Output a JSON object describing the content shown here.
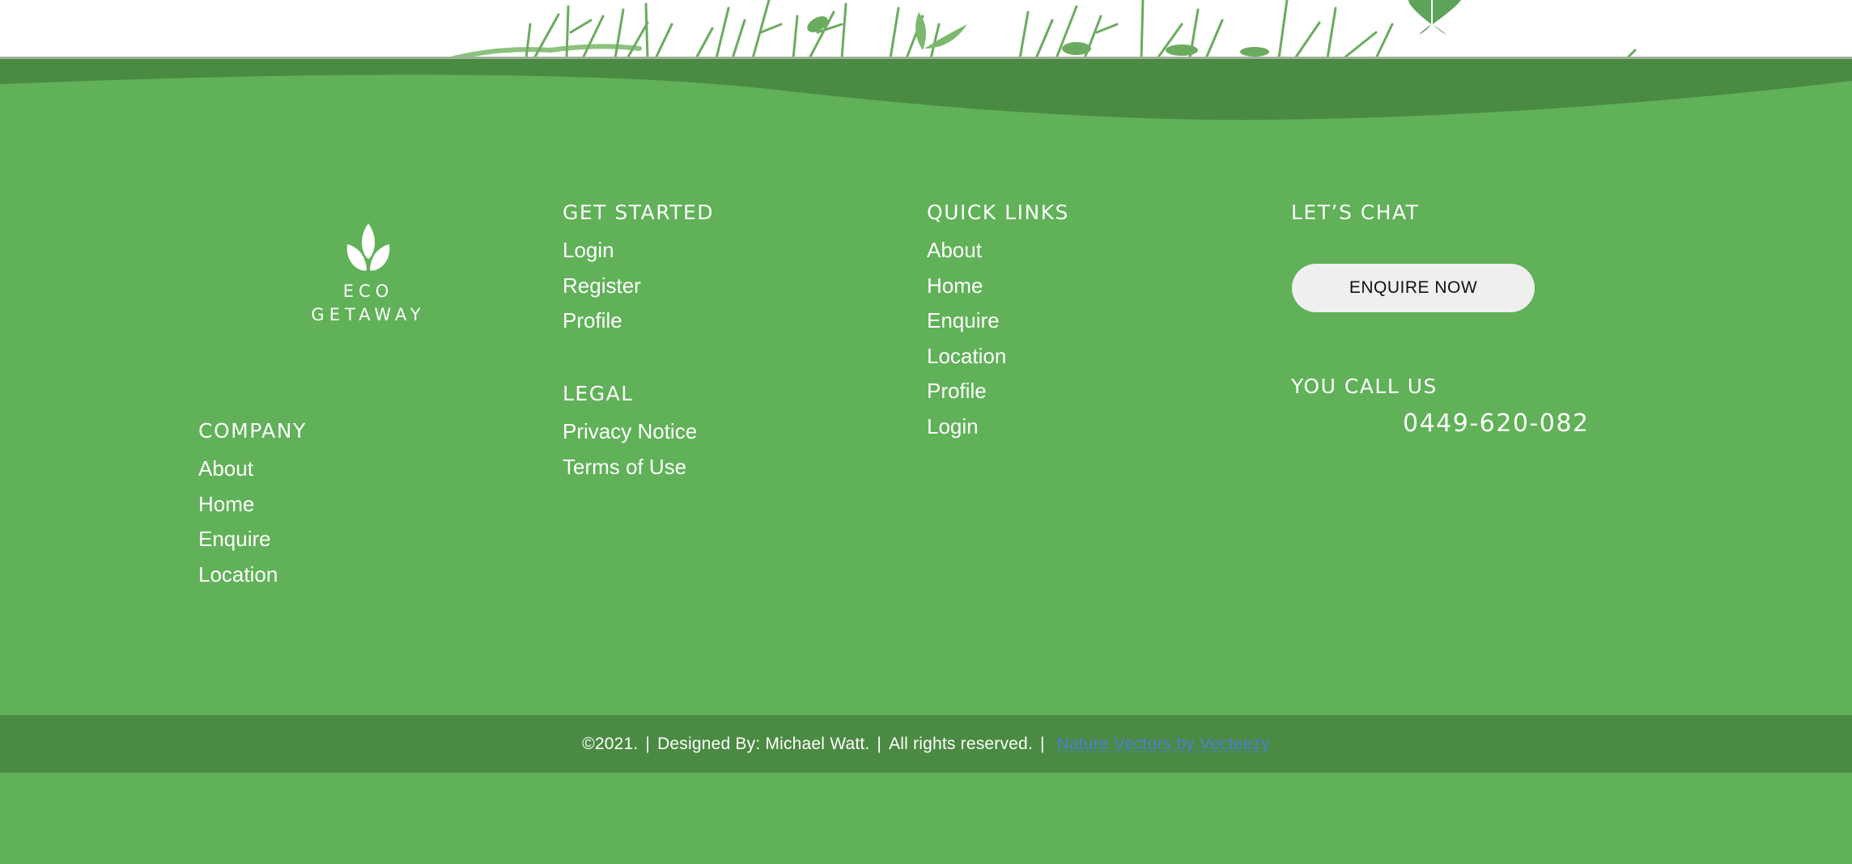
{
  "colors": {
    "footer_green": "#60b158",
    "dark_green": "#4a8a42",
    "button_bg": "#f0eff0",
    "link_blue": "#4a7fd6",
    "text_white": "#ffffff"
  },
  "header_graphic": {
    "icon": "plants-butterflies-illustration"
  },
  "logo": {
    "icon": "three-leaf-icon",
    "line1": "ECO",
    "line2": "GETAWAY"
  },
  "company": {
    "heading": "COMPANY",
    "links": [
      "About",
      "Home",
      "Enquire",
      "Location"
    ]
  },
  "get_started": {
    "heading": "GET STARTED",
    "links": [
      "Login",
      "Register",
      "Profile"
    ]
  },
  "legal": {
    "heading": "LEGAL",
    "links": [
      "Privacy Notice",
      "Terms of Use"
    ]
  },
  "quick_links": {
    "heading": "QUICK LINKS",
    "links": [
      "About",
      "Home",
      "Enquire",
      "Location",
      "Profile",
      "Login"
    ]
  },
  "chat": {
    "heading": "LET’S CHAT",
    "button_label": "ENQUIRE NOW"
  },
  "call": {
    "heading": "YOU CALL US",
    "phone": "0449-620-082"
  },
  "footer_bar": {
    "copyright": "©2021.",
    "designer": "Designed By: Michael Watt.",
    "rights": "All rights reserved.",
    "separator": "|",
    "credit_link": "Nature Vectors by Vecteezy"
  }
}
